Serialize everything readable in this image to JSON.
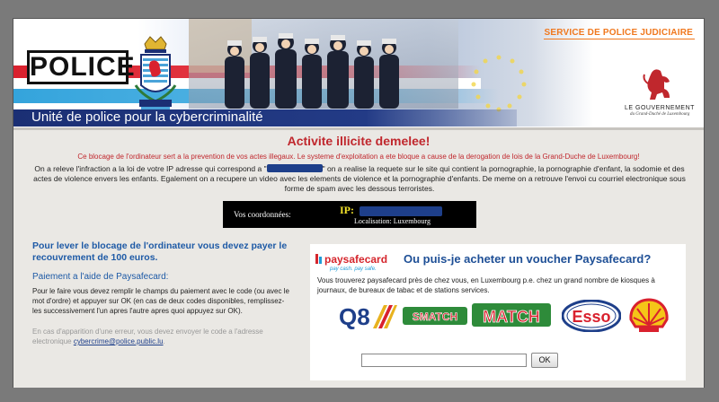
{
  "header": {
    "police_label": "POLICE",
    "unit_title": "Unité de police pour la cybercriminalité",
    "service_title": "SERVICE DE POLICE JUDICIAIRE",
    "government_title": "LE GOUVERNEMENT",
    "government_subtitle": "du Grand-Duché de Luxembourg"
  },
  "notice": {
    "title": "Activite illicite demelee!",
    "subtitle": "Ce blocage de l'ordinateur sert a la prevention de vos actes illegaux. Le systeme d'exploitation a ete bloque a cause de la derogation de lois de la Grand-Duche de Luxembourg!",
    "body_before": "On a releve l'infraction a la loi de votre IP adresse qui correspond a \"",
    "body_after": "\" on a realise la requete sur le site qui contient la pornographie, la pornographie d'enfant, la sodomie et des actes de violence envers les enfants. Egalement on a recupere un video avec les elements de violence et la pornographie d'enfants. De meme on a retrouve l'envoi cu courriel electronique sous forme de spam avec les dessous terroristes."
  },
  "coordinates": {
    "label": "Vos coordonnées:",
    "ip_label": "IP:",
    "location": "Localisation: Luxembourg"
  },
  "payment_left": {
    "heading": "Pour lever le blocage de l'ordinateur vous devez payer le recouvrement de 100 euros.",
    "subheading": "Paiement a l'aide de Paysafecard:",
    "body": "Pour le faire vous devez remplir le champs du paiement avec le code (ou avec le mot d'ordre) et appuyer sur OK (en cas de deux codes disponibles, remplissez-les successivement l'un apres l'autre apres quoi appuyez sur OK).",
    "error_text": "En cas d'apparition d'une erreur, vous devez envoyer le code a l'adresse electronique ",
    "email": "cybercrime@police.public.lu",
    "error_end": "."
  },
  "payment_right": {
    "brand_name": "paysafecard",
    "brand_tagline": "pay cash. pay safe.",
    "heading": "Ou puis-je acheter un voucher Paysafecard?",
    "body": "Vous trouverez paysafecard près de chez vous, en Luxembourg p.e. chez un grand nombre de kiosques à journaux, de bureaux de tabac et de stations services.",
    "retailers": [
      "Q8",
      "SMATCH",
      "MATCH",
      "Esso",
      "Shell"
    ],
    "code_input_value": "",
    "ok_label": "OK"
  },
  "colors": {
    "accent_red": "#c0272d",
    "link_blue": "#1e5aa6",
    "navy": "#1b2f74",
    "orange": "#f0781e"
  }
}
